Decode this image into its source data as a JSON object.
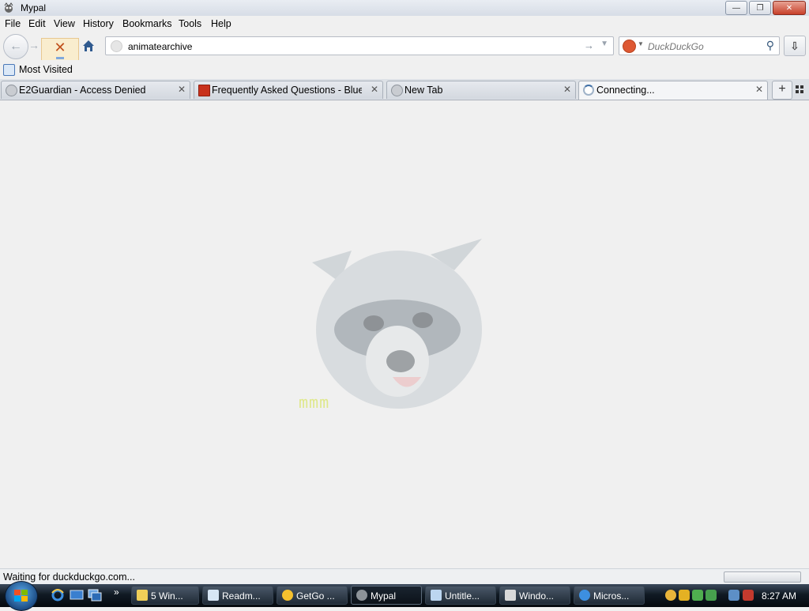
{
  "window": {
    "title": "Mypal"
  },
  "menu": {
    "file": "File",
    "edit": "Edit",
    "view": "View",
    "history": "History",
    "bookmarks": "Bookmarks",
    "tools": "Tools",
    "help": "Help"
  },
  "navbar": {
    "url_value": "animatearchive",
    "search_placeholder": "DuckDuckGo"
  },
  "bookmarks_bar": {
    "most_visited": "Most Visited"
  },
  "tabs": [
    {
      "label": "E2Guardian - Access Denied",
      "icon": "globe-icon"
    },
    {
      "label": "Frequently Asked Questions - Blue...",
      "icon": "bluegriffon-icon"
    },
    {
      "label": "New Tab",
      "icon": "globe-icon"
    },
    {
      "label": "Connecting...",
      "icon": "loading-icon",
      "active": true
    }
  ],
  "content": {
    "loading_text": "mmm"
  },
  "status": {
    "text": "Waiting for duckduckgo.com..."
  },
  "taskbar": {
    "tasks": [
      {
        "label": "5 Win...",
        "icon": "folder-icon"
      },
      {
        "label": "Readm...",
        "icon": "notepad-icon"
      },
      {
        "label": "GetGo ...",
        "icon": "getgo-icon"
      },
      {
        "label": "Mypal",
        "icon": "mypal-icon",
        "active": true
      },
      {
        "label": "Untitle...",
        "icon": "paint-icon"
      },
      {
        "label": "Windo...",
        "icon": "windows-icon"
      },
      {
        "label": "Micros...",
        "icon": "ie-icon"
      }
    ],
    "clock": "8:27 AM"
  },
  "colors": {
    "taskbar": "#0c1219",
    "accent": "#3f6fa6",
    "close": "#c8402a"
  }
}
